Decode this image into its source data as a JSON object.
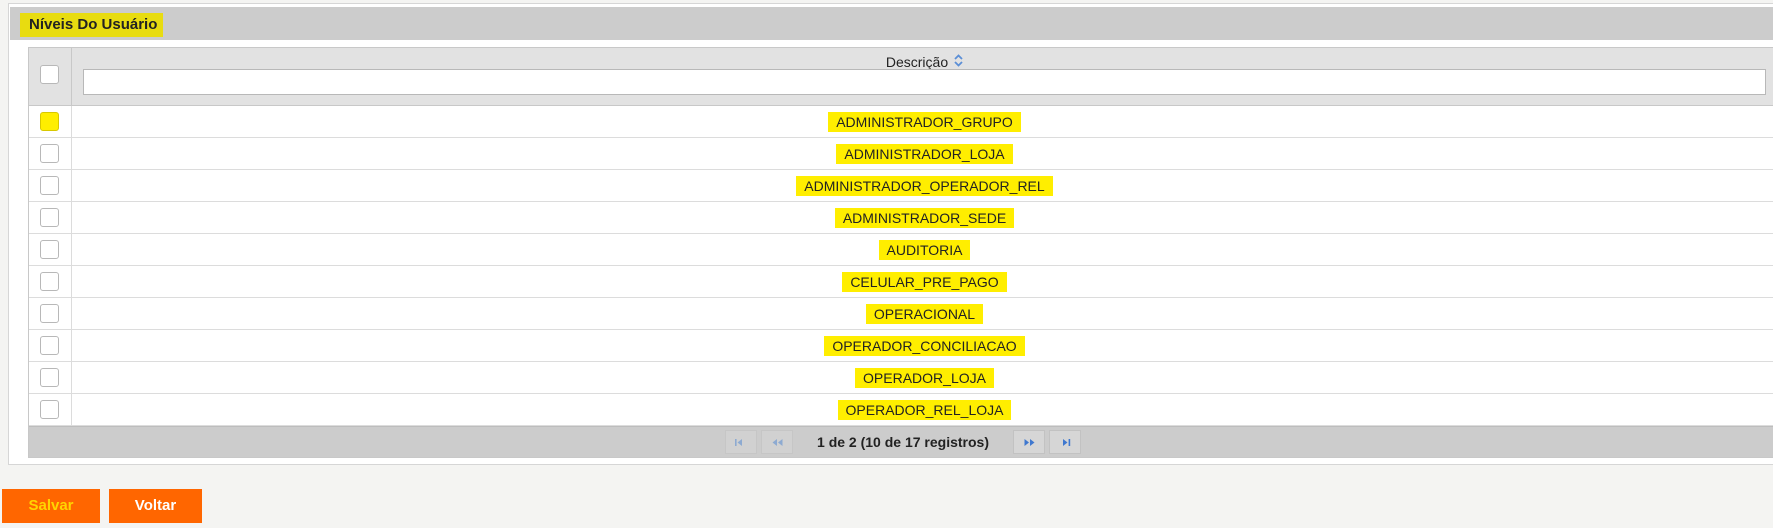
{
  "panel": {
    "title": "Níveis Do Usuário"
  },
  "table": {
    "column_header": "Descrição",
    "filter_value": "",
    "filter_placeholder": "",
    "rows": [
      {
        "descricao": "ADMINISTRADOR_GRUPO",
        "checkbox_highlighted": true
      },
      {
        "descricao": "ADMINISTRADOR_LOJA",
        "checkbox_highlighted": false
      },
      {
        "descricao": "ADMINISTRADOR_OPERADOR_REL",
        "checkbox_highlighted": false
      },
      {
        "descricao": "ADMINISTRADOR_SEDE",
        "checkbox_highlighted": false
      },
      {
        "descricao": "AUDITORIA",
        "checkbox_highlighted": false
      },
      {
        "descricao": "CELULAR_PRE_PAGO",
        "checkbox_highlighted": false
      },
      {
        "descricao": "OPERACIONAL",
        "checkbox_highlighted": false
      },
      {
        "descricao": "OPERADOR_CONCILIACAO",
        "checkbox_highlighted": false
      },
      {
        "descricao": "OPERADOR_LOJA",
        "checkbox_highlighted": false
      },
      {
        "descricao": "OPERADOR_REL_LOJA",
        "checkbox_highlighted": false
      }
    ]
  },
  "paginator": {
    "report": "1 de 2 (10 de 17 registros)",
    "icons": {
      "first": "first-page-icon",
      "prev": "prev-page-icon",
      "next": "next-page-icon",
      "last": "last-page-icon"
    }
  },
  "buttons": {
    "save_label": "Salvar",
    "back_label": "Voltar"
  },
  "colors": {
    "highlight": "#ffee00",
    "header_bg": "#cccccc",
    "button_bg": "#ff6600",
    "save_text": "#ffd400",
    "pager_icon": "#5b8fd6"
  }
}
